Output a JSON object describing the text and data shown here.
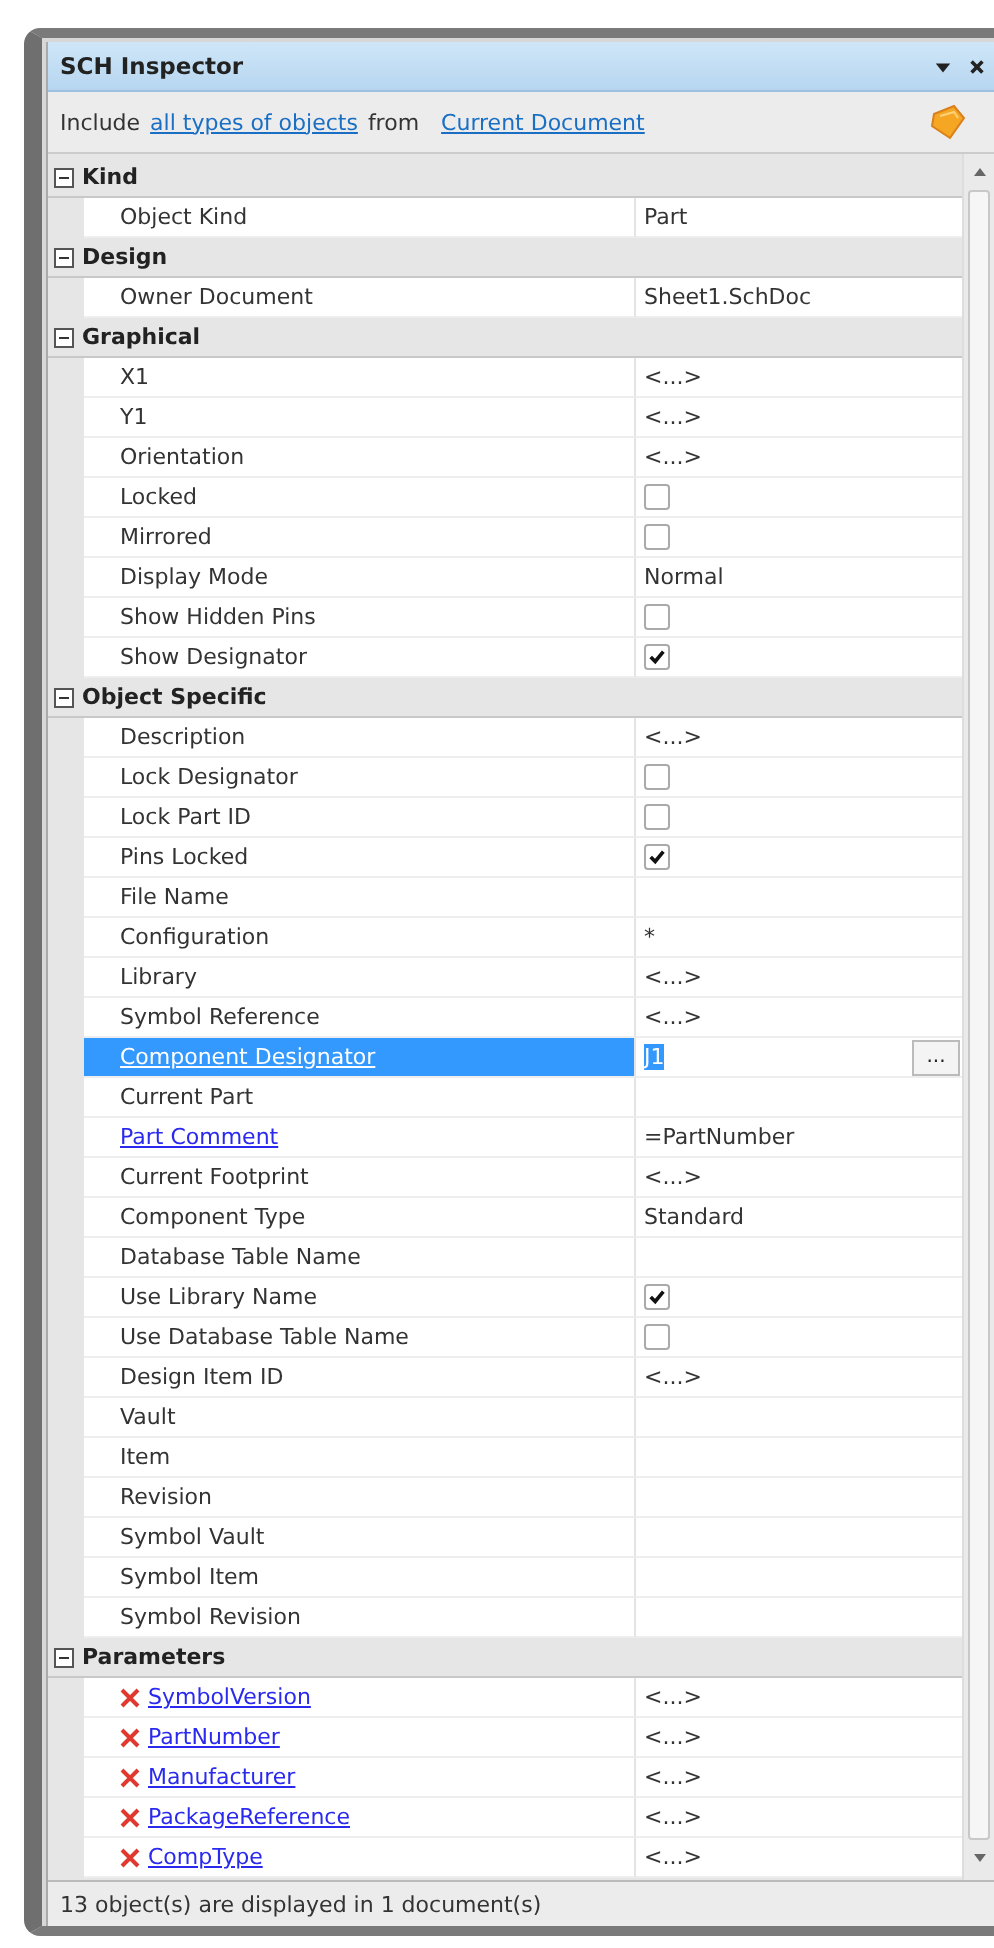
{
  "window": {
    "title": "SCH Inspector"
  },
  "filter": {
    "prefix": "Include",
    "object_link": "all types of objects",
    "middle": "from",
    "scope_link": "Current Document"
  },
  "sections": [
    {
      "title": "Kind",
      "expanded": true,
      "rows": [
        {
          "kind": "text",
          "name": "Object Kind",
          "value": "Part"
        }
      ]
    },
    {
      "title": "Design",
      "expanded": true,
      "rows": [
        {
          "kind": "text",
          "name": "Owner Document",
          "value": "Sheet1.SchDoc"
        }
      ]
    },
    {
      "title": "Graphical",
      "expanded": true,
      "rows": [
        {
          "kind": "text",
          "name": "X1",
          "value": "<...>"
        },
        {
          "kind": "text",
          "name": "Y1",
          "value": "<...>"
        },
        {
          "kind": "text",
          "name": "Orientation",
          "value": "<...>"
        },
        {
          "kind": "checkbox",
          "name": "Locked",
          "checked": false
        },
        {
          "kind": "checkbox",
          "name": "Mirrored",
          "checked": false
        },
        {
          "kind": "text",
          "name": "Display Mode",
          "value": "Normal"
        },
        {
          "kind": "checkbox",
          "name": "Show Hidden Pins",
          "checked": false
        },
        {
          "kind": "checkbox",
          "name": "Show Designator",
          "checked": true
        }
      ]
    },
    {
      "title": "Object Specific",
      "expanded": true,
      "rows": [
        {
          "kind": "text",
          "name": "Description",
          "value": "<...>"
        },
        {
          "kind": "checkbox",
          "name": "Lock Designator",
          "checked": false
        },
        {
          "kind": "checkbox",
          "name": "Lock Part ID",
          "checked": false
        },
        {
          "kind": "checkbox",
          "name": "Pins Locked",
          "checked": true
        },
        {
          "kind": "text",
          "name": "File Name"
        },
        {
          "kind": "text",
          "name": "Configuration",
          "value": "*"
        },
        {
          "kind": "text",
          "name": "Library",
          "value": "<...>"
        },
        {
          "kind": "text",
          "name": "Symbol Reference",
          "value": "<...>"
        },
        {
          "kind": "edit",
          "name": "Component Designator",
          "link": true,
          "selected": true,
          "value": "J1",
          "button": "..."
        },
        {
          "kind": "text",
          "name": "Current Part"
        },
        {
          "kind": "text",
          "name": "Part Comment",
          "link": true,
          "value": "=PartNumber"
        },
        {
          "kind": "text",
          "name": "Current Footprint",
          "value": "<...>"
        },
        {
          "kind": "text",
          "name": "Component Type",
          "value": "Standard"
        },
        {
          "kind": "text",
          "name": "Database Table Name"
        },
        {
          "kind": "checkbox",
          "name": "Use Library Name",
          "checked": true
        },
        {
          "kind": "checkbox",
          "name": "Use Database Table Name",
          "checked": false
        },
        {
          "kind": "text",
          "name": "Design Item ID",
          "value": "<...>"
        },
        {
          "kind": "text",
          "name": "Vault"
        },
        {
          "kind": "text",
          "name": "Item"
        },
        {
          "kind": "text",
          "name": "Revision"
        },
        {
          "kind": "text",
          "name": "Symbol Vault"
        },
        {
          "kind": "text",
          "name": "Symbol Item"
        },
        {
          "kind": "text",
          "name": "Symbol Revision"
        }
      ]
    },
    {
      "title": "Parameters",
      "expanded": true,
      "rows": [
        {
          "kind": "parameter",
          "name": "SymbolVersion",
          "value": "<...>"
        },
        {
          "kind": "parameter",
          "name": "PartNumber",
          "value": "<...>"
        },
        {
          "kind": "parameter",
          "name": "Manufacturer",
          "value": "<...>"
        },
        {
          "kind": "parameter",
          "name": "PackageReference",
          "value": "<...>"
        },
        {
          "kind": "parameter",
          "name": "CompType",
          "value": "<...>"
        }
      ]
    }
  ],
  "status_bar": "13 object(s) are displayed in 1 document(s)"
}
